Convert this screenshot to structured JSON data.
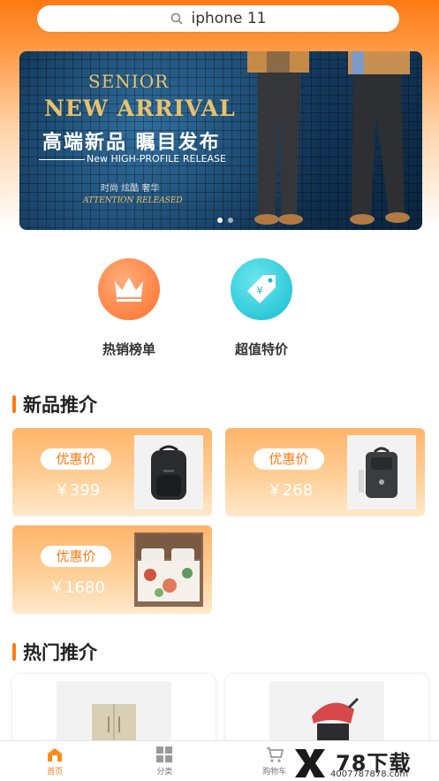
{
  "search": {
    "query": "iphone 11"
  },
  "banner": {
    "line1": "SENIOR",
    "line2": "NEW ARRIVAL",
    "line3": "高端新品 瞩目发布",
    "line4": "New HIGH-PROFILE RELEASE",
    "line5": "时尚 炫酷 奢华",
    "line6": "ATTENTION RELEASED",
    "slide_count": 2,
    "active_slide": 1
  },
  "categories": [
    {
      "label": "热销榜单",
      "icon": "crown-icon",
      "color": "#ff7f3a"
    },
    {
      "label": "超值特价",
      "icon": "price-tag-icon",
      "color": "#1fc8d8"
    }
  ],
  "new_section": {
    "title": "新品推介",
    "items": [
      {
        "badge": "优惠价",
        "price": "￥399",
        "image": "backpack-black"
      },
      {
        "badge": "优惠价",
        "price": "￥268",
        "image": "backpack-slim"
      },
      {
        "badge": "优惠价",
        "price": "￥1680",
        "image": "bedding-set"
      }
    ]
  },
  "hot_section": {
    "title": "热门推介",
    "items": [
      {
        "image": "refrigerator"
      },
      {
        "image": "stroller"
      }
    ]
  },
  "tabbar": {
    "tabs": [
      {
        "label": "首页",
        "icon": "home-icon",
        "active": true
      },
      {
        "label": "分类",
        "icon": "grid-icon",
        "active": false
      },
      {
        "label": "购物车",
        "icon": "cart-icon",
        "active": false
      },
      {
        "label": "",
        "icon": "",
        "active": false
      }
    ]
  },
  "watermark": {
    "main": "78下载",
    "sub": "4007787878.com"
  },
  "colors": {
    "accent": "#ff7a12",
    "teal": "#1fc8d8"
  }
}
